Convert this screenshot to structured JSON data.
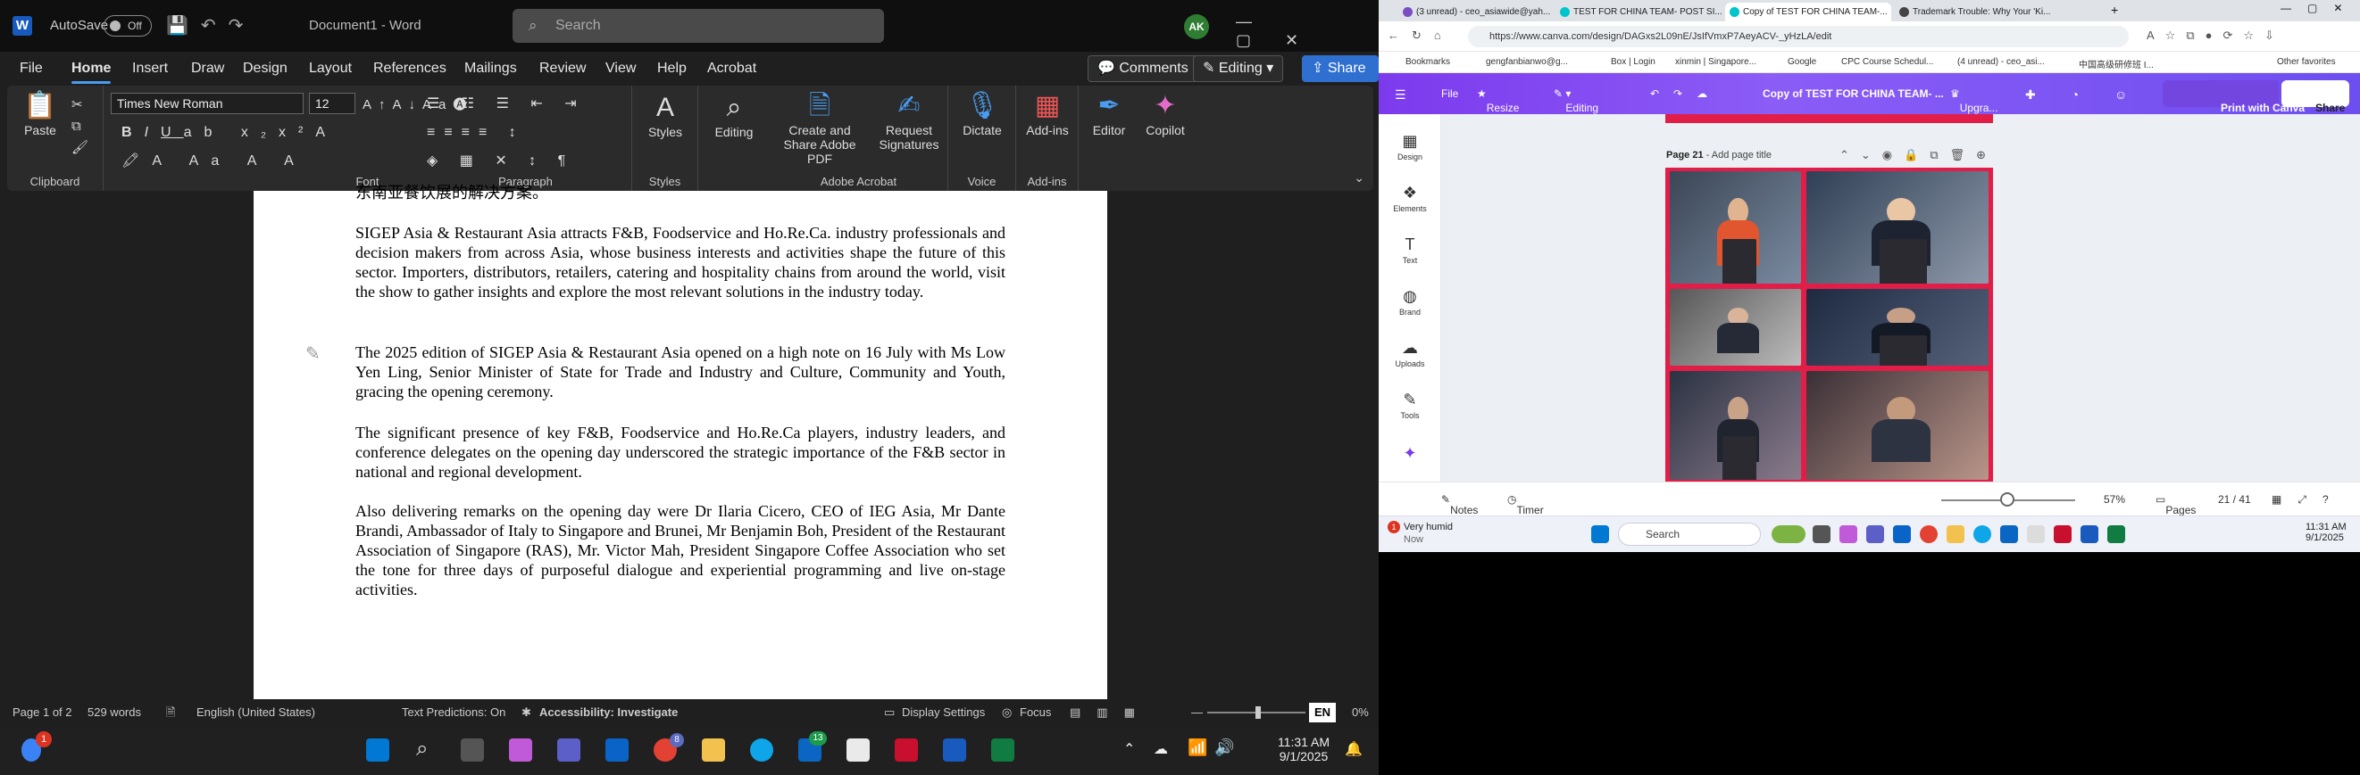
{
  "word": {
    "autosave_label": "AutoSave",
    "autosave_state": "Off",
    "doc_title": "Document1 - Word",
    "search_placeholder": "Search",
    "avatar": "AK",
    "menu": [
      "File",
      "Home",
      "Insert",
      "Draw",
      "Design",
      "Layout",
      "References",
      "Mailings",
      "Review",
      "View",
      "Help",
      "Acrobat"
    ],
    "comments_label": "Comments",
    "editing_label": "Editing",
    "share_label": "Share",
    "ribbon": {
      "paste": "Paste",
      "clipboard": "Clipboard",
      "font_name": "Times New Roman",
      "font_size": "12",
      "font_group": "Font",
      "paragraph_group": "Paragraph",
      "styles": "Styles",
      "styles_group": "Styles",
      "editing": "Editing",
      "create_share": "Create and Share Adobe PDF",
      "request_sig": "Request Signatures",
      "acrobat_group": "Adobe Acrobat",
      "dictate": "Dictate",
      "voice_group": "Voice",
      "addins": "Add-ins",
      "addins_group": "Add-ins",
      "editor": "Editor",
      "copilot": "Copilot"
    },
    "document": {
      "cutoff": "东南亚餐饮展的解决方案。",
      "p1": "SIGEP Asia & Restaurant Asia attracts F&B, Foodservice and Ho.Re.Ca. industry professionals and decision makers from across Asia, whose business interests and activities shape the future of this sector. Importers, distributors, retailers, catering and hospitality chains from around the world, visit the show to gather insights and explore the most relevant solutions in the industry today.",
      "p2": "The 2025 edition of SIGEP Asia & Restaurant Asia opened on a high note on 16 July with Ms Low Yen Ling, Senior Minister of State for Trade and Industry and Culture, Community and Youth, gracing the opening ceremony.",
      "p3": "The significant presence of key F&B, Foodservice and Ho.Re.Ca players, industry leaders, and conference delegates on the opening day underscored the strategic importance of the F&B sector in national and regional development.",
      "p4": "Also delivering remarks on the opening day were Dr Ilaria Cicero, CEO of IEG Asia, Mr Dante Brandi, Ambassador of Italy to Singapore and Brunei, Mr Benjamin Boh, President of the Restaurant Association of Singapore (RAS), Mr. Victor Mah, President Singapore Coffee Association who set the tone for three days of purposeful dialogue and experiential programming and live on-stage activities."
    },
    "status": {
      "page": "Page 1 of 2",
      "words": "529 words",
      "language": "English (United States)",
      "predictions": "Text Predictions: On",
      "accessibility": "Accessibility: Investigate",
      "display": "Display Settings",
      "focus": "Focus",
      "zoom": "0%",
      "lang_badge": "EN"
    },
    "taskbar": {
      "time": "11:31 AM",
      "date": "9/1/2025",
      "badge_linkedin": "13",
      "badge_chrome": "8",
      "badge_start": "1"
    }
  },
  "browser": {
    "tabs": [
      "(3 unread) - ceo_asiawide@yah...",
      "TEST FOR CHINA TEAM- POST SI...",
      "Copy of TEST FOR CHINA TEAM-...",
      "Trademark Trouble: Why Your 'Ki..."
    ],
    "url": "https://www.canva.com/design/DAGxs2L09nE/JsIfVmxP7AeyACV-_yHzLA/edit",
    "bookmarks": [
      "Bookmarks",
      "gengfanbianwo@g...",
      "Box | Login",
      "xinmin | Singapore...",
      "Google",
      "CPC Course Schedul...",
      "(4 unread) - ceo_asi...",
      "中国高级研修班 I...",
      "Other favorites"
    ],
    "canva": {
      "file": "File",
      "resize": "Resize",
      "editing": "Editing",
      "design_title": "Copy of TEST FOR CHINA TEAM- ...",
      "upgrade": "Upgra...",
      "print": "Print with Canva",
      "share": "Share",
      "side": [
        "Design",
        "Elements",
        "Text",
        "Brand",
        "Uploads",
        "Tools"
      ],
      "page_label": "Page 21",
      "page_title_placeholder": "Add page title",
      "notes": "Notes",
      "timer": "Timer",
      "zoom": "57%",
      "pages": "Pages",
      "page_count": "21 / 41"
    },
    "taskbar": {
      "weather": "Very humid",
      "weather_sub": "Now",
      "search": "Search",
      "time": "11:31 AM",
      "date": "9/1/2025"
    }
  }
}
